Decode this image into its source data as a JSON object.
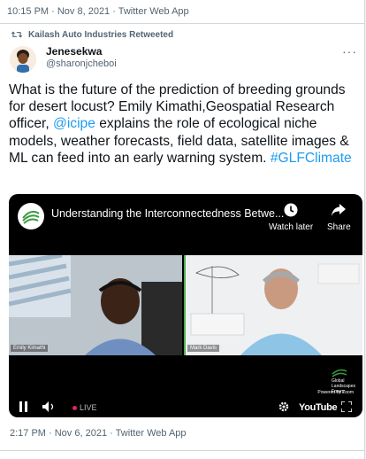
{
  "previous_tweet": {
    "timestamp": "10:15 PM · Nov 8, 2021 · Twitter Web App"
  },
  "retweet": {
    "label": "Kailash Auto Industries Retweeted"
  },
  "author": {
    "name": "Jenesekwa",
    "handle": "@sharonjcheboi"
  },
  "tweet": {
    "text_part1": "What is the future of the prediction of breeding grounds for desert locust? Emily Kimathi,Geospatial Research officer, ",
    "mention": "@icipe",
    "text_part2": " explains the role of ecological niche models, weather forecasts, field data, satellite images & ML can feed into an early warning system. ",
    "hashtag": "#GLFClimate",
    "timestamp": "2:17 PM · Nov 6, 2021 · Twitter Web App"
  },
  "video": {
    "title": "Understanding the Interconnectedness Betwe...",
    "watch_later": "Watch later",
    "share": "Share",
    "speaker_left": "Emily Kimathi",
    "speaker_right": "Mark Davis",
    "glf_text_1": "Global",
    "glf_text_2": "Landscapes",
    "glf_text_3": "Forum",
    "powered_by": "Powered by Zoom",
    "live_label": "LIVE",
    "youtube_label": "YouTube"
  },
  "colors": {
    "link": "#1d9bf0",
    "muted": "#536471",
    "accent_green": "#4caf50"
  }
}
